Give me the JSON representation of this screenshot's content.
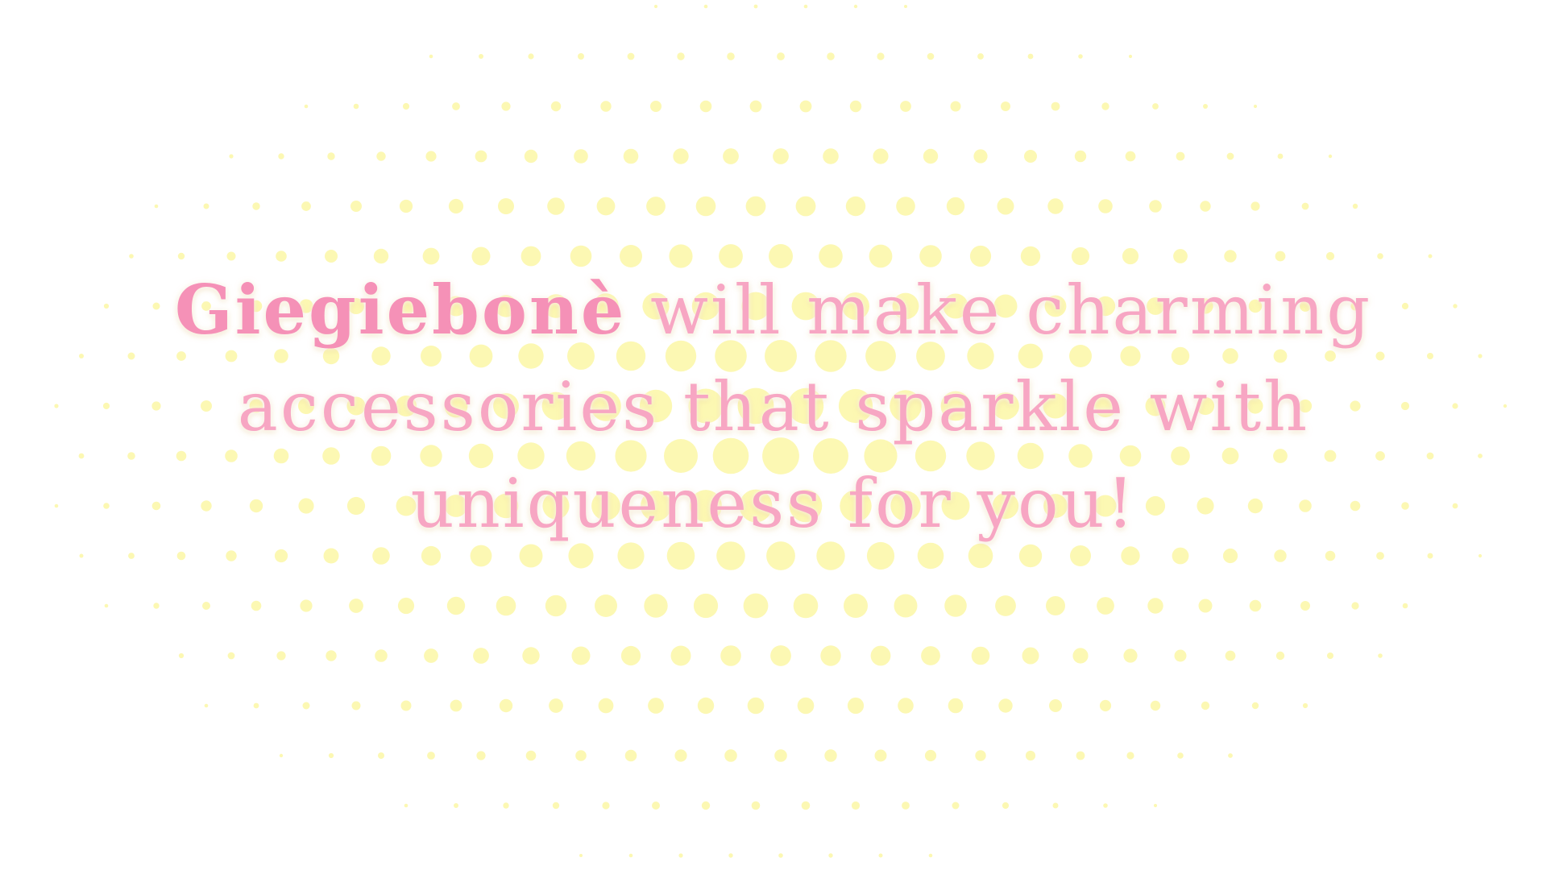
{
  "background": {
    "base_color": "#ffffff",
    "dot_color": "#fbf7a6",
    "pattern": "halftone-dots"
  },
  "tagline": {
    "brand": "Giegiebonè",
    "line1_rest": " will make charming",
    "line2": "accessories that sparkle with",
    "line3": "uniqueness for you!",
    "text_color": "#f7a6c3",
    "brand_color": "#f591b7"
  }
}
